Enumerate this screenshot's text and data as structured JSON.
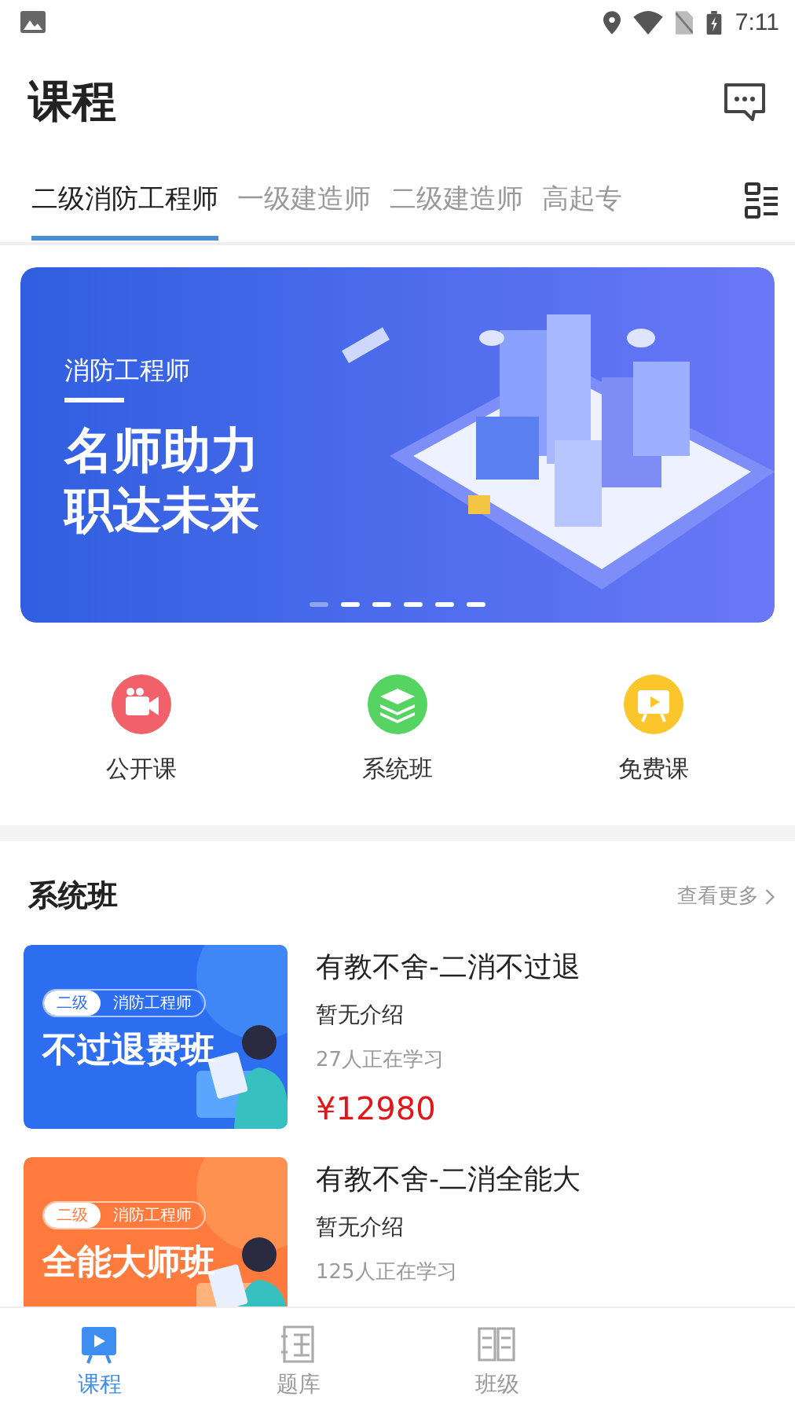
{
  "status_bar": {
    "time": "7:11"
  },
  "header": {
    "title": "课程"
  },
  "tabs": [
    {
      "label": "二级消防工程师",
      "selected": true
    },
    {
      "label": "一级建造师",
      "selected": false
    },
    {
      "label": "二级建造师",
      "selected": false
    },
    {
      "label": "高起专",
      "selected": false
    }
  ],
  "banner": {
    "subtitle": "消防工程师",
    "headline_lines": [
      "名师助力",
      "职达未来"
    ],
    "dots": [
      {
        "selected": true
      },
      {
        "selected": false
      },
      {
        "selected": false
      },
      {
        "selected": false
      },
      {
        "selected": false
      },
      {
        "selected": false
      }
    ]
  },
  "shortcuts": [
    {
      "label": "公开课",
      "kind": "video",
      "color": "#f2606a"
    },
    {
      "label": "系统班",
      "kind": "layers",
      "color": "#56d462"
    },
    {
      "label": "免费课",
      "kind": "screen",
      "color": "#fbc52c"
    }
  ],
  "section": {
    "title": "系统班",
    "more": "查看更多"
  },
  "courses": [
    {
      "title": "有教不舍-二消不过退",
      "intro": "暂无介绍",
      "learners": "27人正在学习",
      "price": "¥12980",
      "thumb": {
        "tag_level": "二级",
        "tag_name": "消防工程师",
        "headline": "不过退费班"
      }
    },
    {
      "title": "有教不舍-二消全能大",
      "intro": "暂无介绍",
      "learners": "125人正在学习",
      "thumb": {
        "tag_level": "二级",
        "tag_name": "消防工程师",
        "headline": "全能大师班"
      }
    }
  ],
  "bottom_nav": [
    {
      "label": "课程",
      "kind": "play",
      "selected": true
    },
    {
      "label": "题库",
      "kind": "bank",
      "selected": false
    },
    {
      "label": "班级",
      "kind": "book",
      "selected": false
    }
  ]
}
